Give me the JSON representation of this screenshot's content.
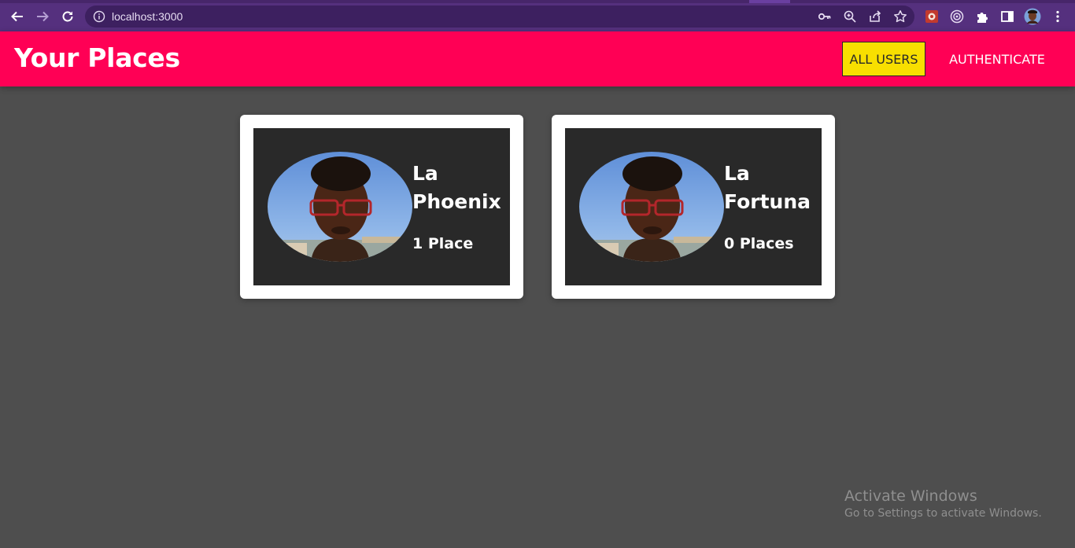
{
  "browser": {
    "url": "localhost:3000",
    "icons": {
      "back": "back-arrow-icon",
      "forward": "forward-arrow-icon",
      "reload": "reload-icon",
      "info": "info-icon",
      "password_key": "key-icon",
      "zoom": "zoom-icon",
      "share": "share-icon",
      "bookmark": "star-icon",
      "extension_1": "extension-icon",
      "extension_2": "extension-icon",
      "extensions_menu": "puzzle-icon",
      "side_panel": "side-panel-icon",
      "profile": "avatar",
      "menu": "kebab-menu-icon"
    },
    "colors": {
      "frame": "#55307e",
      "omnibox": "#3d2060"
    }
  },
  "header": {
    "title": "Your Places",
    "nav": [
      {
        "label": "ALL USERS",
        "active": true
      },
      {
        "label": "AUTHENTICATE",
        "active": false
      }
    ],
    "colors": {
      "background": "#ff0055",
      "active_bg": "#f8df00"
    }
  },
  "users": [
    {
      "name": "La Phoenix",
      "places": "1 Place"
    },
    {
      "name": "La Fortuna",
      "places": "0 Places"
    }
  ],
  "watermark": {
    "title": "Activate Windows",
    "subtitle": "Go to Settings to activate Windows."
  }
}
